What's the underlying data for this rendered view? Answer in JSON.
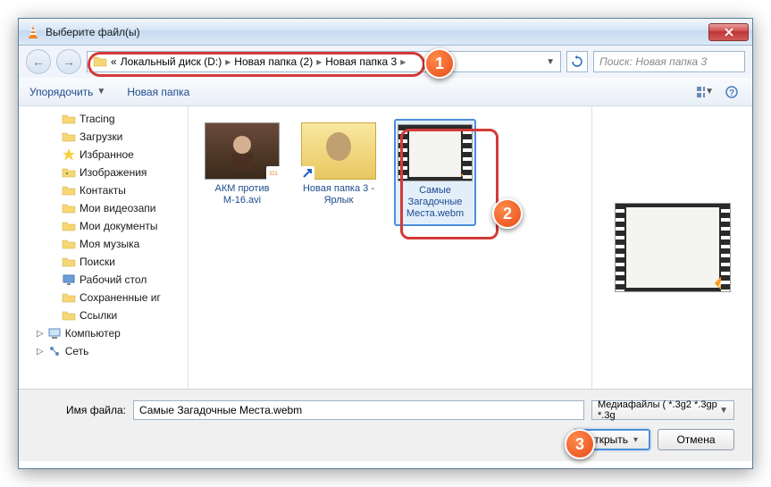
{
  "window": {
    "title": "Выберите файл(ы)"
  },
  "nav": {
    "breadcrumb_prefix": "«",
    "crumbs": [
      "Локальный диск (D:)",
      "Новая папка (2)",
      "Новая папка 3"
    ],
    "search_placeholder": "Поиск: Новая папка 3"
  },
  "toolbar": {
    "organize": "Упорядочить",
    "newfolder": "Новая папка"
  },
  "sidebar": {
    "items": [
      {
        "label": "Tracing",
        "icon": "folder"
      },
      {
        "label": "Загрузки",
        "icon": "folder"
      },
      {
        "label": "Избранное",
        "icon": "favorites"
      },
      {
        "label": "Изображения",
        "icon": "pictures"
      },
      {
        "label": "Контакты",
        "icon": "contacts"
      },
      {
        "label": "Мои видеозапи",
        "icon": "videos"
      },
      {
        "label": "Мои документы",
        "icon": "documents"
      },
      {
        "label": "Моя музыка",
        "icon": "music"
      },
      {
        "label": "Поиски",
        "icon": "search"
      },
      {
        "label": "Рабочий стол",
        "icon": "desktop"
      },
      {
        "label": "Сохраненные иг",
        "icon": "games"
      },
      {
        "label": "Ссылки",
        "icon": "links"
      }
    ],
    "roots": [
      {
        "label": "Компьютер",
        "icon": "computer"
      },
      {
        "label": "Сеть",
        "icon": "network"
      }
    ]
  },
  "files": [
    {
      "name": "АКМ против М-16.avi",
      "type": "video"
    },
    {
      "name": "Новая папка 3 - Ярлык",
      "type": "folder-shortcut"
    },
    {
      "name": "Самые Загадочные Места.webm",
      "type": "video",
      "selected": true
    }
  ],
  "bottom": {
    "filename_label": "Имя файла:",
    "filename_value": "Самые Загадочные Места.webm",
    "filter_label": "Медиафайлы ( *.3g2 *.3gp *.3g",
    "open": "Открыть",
    "cancel": "Отмена"
  },
  "markers": {
    "m1": "1",
    "m2": "2",
    "m3": "3"
  }
}
